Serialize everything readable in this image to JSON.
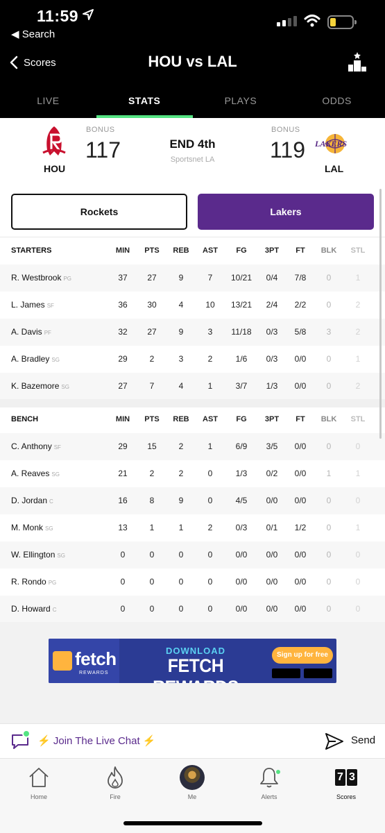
{
  "status_bar": {
    "time": "11:59",
    "back_app": "Search"
  },
  "nav": {
    "back_label": "Scores",
    "title": "HOU vs LAL"
  },
  "tabs": [
    {
      "label": "LIVE",
      "active": false
    },
    {
      "label": "STATS",
      "active": true
    },
    {
      "label": "PLAYS",
      "active": false
    },
    {
      "label": "ODDS",
      "active": false
    }
  ],
  "game": {
    "home": {
      "abbr": "HOU",
      "score": "117",
      "bonus": "BONUS",
      "color": "#c8102e"
    },
    "away": {
      "abbr": "LAL",
      "score": "119",
      "bonus": "BONUS",
      "color": "#552583"
    },
    "status": "END 4th",
    "network": "Sportsnet LA"
  },
  "team_toggle": {
    "left": "Rockets",
    "right": "Lakers",
    "selected": "Lakers",
    "selected_color": "#5a2a8c"
  },
  "stat_columns": [
    "MIN",
    "PTS",
    "REB",
    "AST",
    "FG",
    "3PT",
    "FT",
    "BLK",
    "STL"
  ],
  "starters": {
    "label": "STARTERS",
    "players": [
      {
        "name": "R. Westbrook",
        "pos": "PG",
        "stats": [
          "37",
          "27",
          "9",
          "7",
          "10/21",
          "0/4",
          "7/8",
          "0",
          "1"
        ]
      },
      {
        "name": "L. James",
        "pos": "SF",
        "stats": [
          "36",
          "30",
          "4",
          "10",
          "13/21",
          "2/4",
          "2/2",
          "0",
          "2"
        ]
      },
      {
        "name": "A. Davis",
        "pos": "PF",
        "stats": [
          "32",
          "27",
          "9",
          "3",
          "11/18",
          "0/3",
          "5/8",
          "3",
          "2"
        ]
      },
      {
        "name": "A. Bradley",
        "pos": "SG",
        "stats": [
          "29",
          "2",
          "3",
          "2",
          "1/6",
          "0/3",
          "0/0",
          "0",
          "1"
        ]
      },
      {
        "name": "K. Bazemore",
        "pos": "SG",
        "stats": [
          "27",
          "7",
          "4",
          "1",
          "3/7",
          "1/3",
          "0/0",
          "0",
          "2"
        ]
      }
    ]
  },
  "bench": {
    "label": "BENCH",
    "players": [
      {
        "name": "C. Anthony",
        "pos": "SF",
        "stats": [
          "29",
          "15",
          "2",
          "1",
          "6/9",
          "3/5",
          "0/0",
          "0",
          "0"
        ]
      },
      {
        "name": "A. Reaves",
        "pos": "SG",
        "stats": [
          "21",
          "2",
          "2",
          "0",
          "1/3",
          "0/2",
          "0/0",
          "1",
          "1"
        ]
      },
      {
        "name": "D. Jordan",
        "pos": "C",
        "stats": [
          "16",
          "8",
          "9",
          "0",
          "4/5",
          "0/0",
          "0/0",
          "0",
          "0"
        ]
      },
      {
        "name": "M. Monk",
        "pos": "SG",
        "stats": [
          "13",
          "1",
          "1",
          "2",
          "0/3",
          "0/1",
          "1/2",
          "0",
          "1"
        ]
      },
      {
        "name": "W. Ellington",
        "pos": "SG",
        "stats": [
          "0",
          "0",
          "0",
          "0",
          "0/0",
          "0/0",
          "0/0",
          "0",
          "0"
        ]
      },
      {
        "name": "R. Rondo",
        "pos": "PG",
        "stats": [
          "0",
          "0",
          "0",
          "0",
          "0/0",
          "0/0",
          "0/0",
          "0",
          "0"
        ]
      },
      {
        "name": "D. Howard",
        "pos": "C",
        "stats": [
          "0",
          "0",
          "0",
          "0",
          "0/0",
          "0/0",
          "0/0",
          "0",
          "0"
        ]
      }
    ]
  },
  "ad": {
    "brand": "fetch",
    "brand_sub": "REWARDS",
    "download": "DOWNLOAD",
    "headline": "FETCH REWARDS",
    "cta": "Sign up for free"
  },
  "chat": {
    "label": "Join The Live Chat",
    "send": "Send"
  },
  "tab_bar": [
    {
      "label": "Home",
      "icon": "home-icon"
    },
    {
      "label": "Fire",
      "icon": "fire-icon"
    },
    {
      "label": "Me",
      "icon": "avatar"
    },
    {
      "label": "Alerts",
      "icon": "bell-icon"
    },
    {
      "label": "Scores",
      "icon": "scoreboard-icon",
      "digits": [
        "7",
        "3"
      ],
      "active": true
    }
  ]
}
